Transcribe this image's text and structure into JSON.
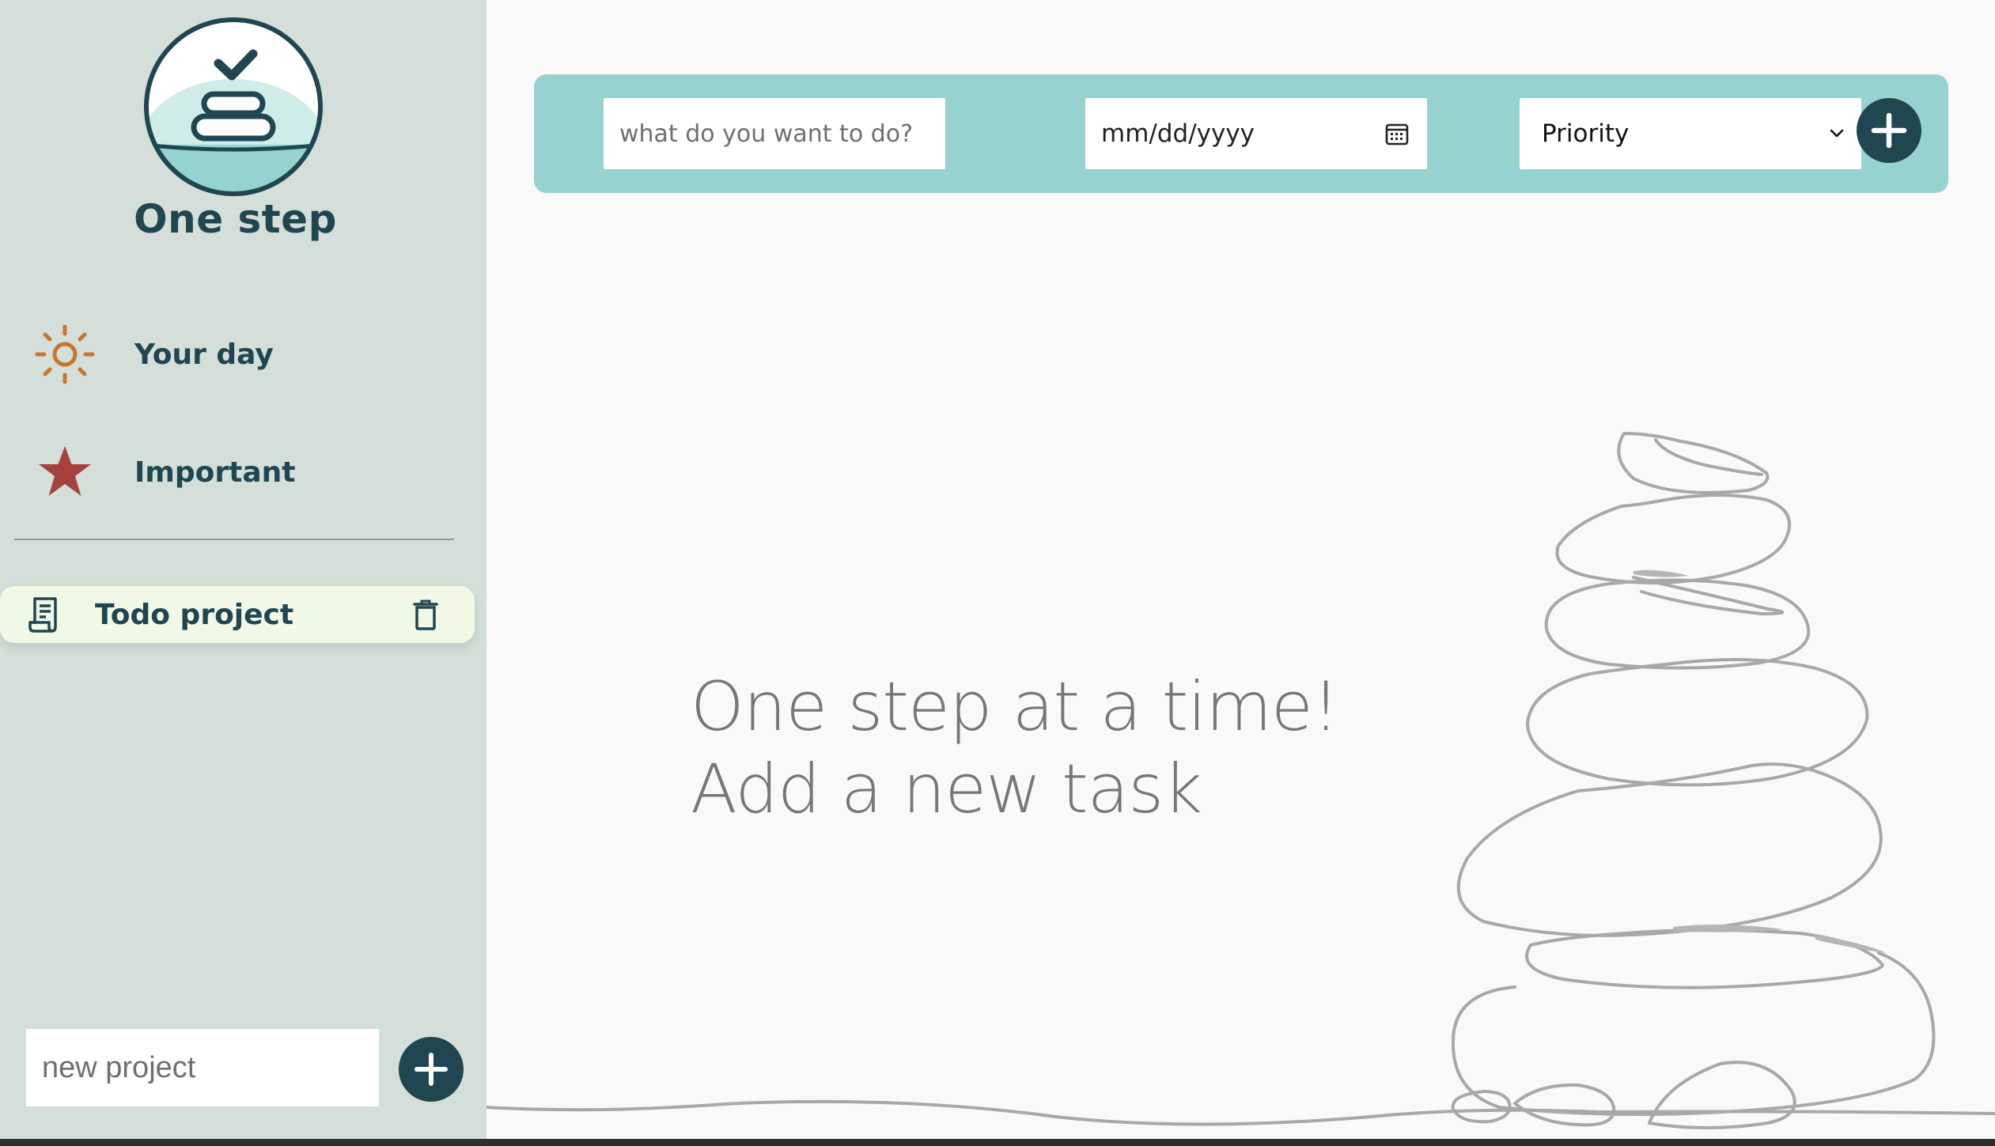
{
  "brand": {
    "name": "One step"
  },
  "sidebar": {
    "nav": [
      {
        "label": "Your day",
        "icon": "sun-icon"
      },
      {
        "label": "Important",
        "icon": "star-icon"
      }
    ],
    "projects": [
      {
        "label": "Todo project",
        "icon": "notepad-icon"
      }
    ],
    "new_project": {
      "placeholder": "new project"
    }
  },
  "task_bar": {
    "task_placeholder": "what do you want to do?",
    "date_placeholder": "mm/dd/yyyy",
    "priority_selected": "Priority"
  },
  "empty_state": {
    "line1": "One step at a time!",
    "line2": "Add a new task"
  },
  "colors": {
    "sidebar_bg": "#d3dfd8",
    "accent_dark": "#1f4651",
    "task_bar_bg": "#96d2cf",
    "sun_orange": "#c9762f",
    "star_red": "#a6413e",
    "active_project_bg": "#f2f8e6"
  }
}
